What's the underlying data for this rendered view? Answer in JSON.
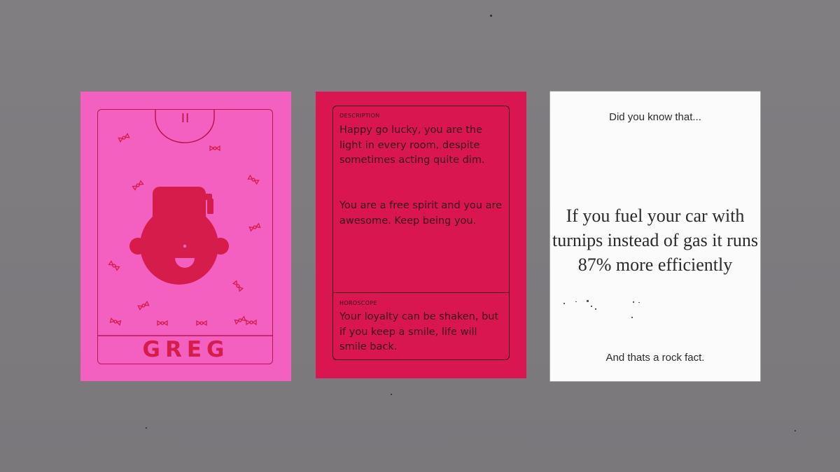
{
  "character_card": {
    "numeral": "II",
    "name": "GREG",
    "colors": {
      "card": "#f360c0",
      "ink": "#d51c4a",
      "line": "#b8174d"
    },
    "icons": [
      "candy-icon",
      "character-face-icon"
    ]
  },
  "description_card": {
    "description_label": "DESCRIPTION",
    "description_text_1": "Happy go lucky, you are the light in every room, despite sometimes acting quite dim.",
    "description_text_2": "You are a free spirit and you are awesome. Keep being you.",
    "horoscope_label": "HOROSCOPE",
    "horoscope_text": "Your loyalty can be shaken, but if you keep a smile, life will smile back.",
    "colors": {
      "card": "#d9164f",
      "ink": "#3a0d1a"
    }
  },
  "fact_card": {
    "intro": "Did you know that...",
    "fact": "If you fuel your car with turnips instead of gas it runs 87% more efficiently",
    "outro": "And thats a rock fact.",
    "colors": {
      "card": "#fbfbfb",
      "ink": "#2a2a2a"
    }
  },
  "background_color": "#7d7b7e"
}
